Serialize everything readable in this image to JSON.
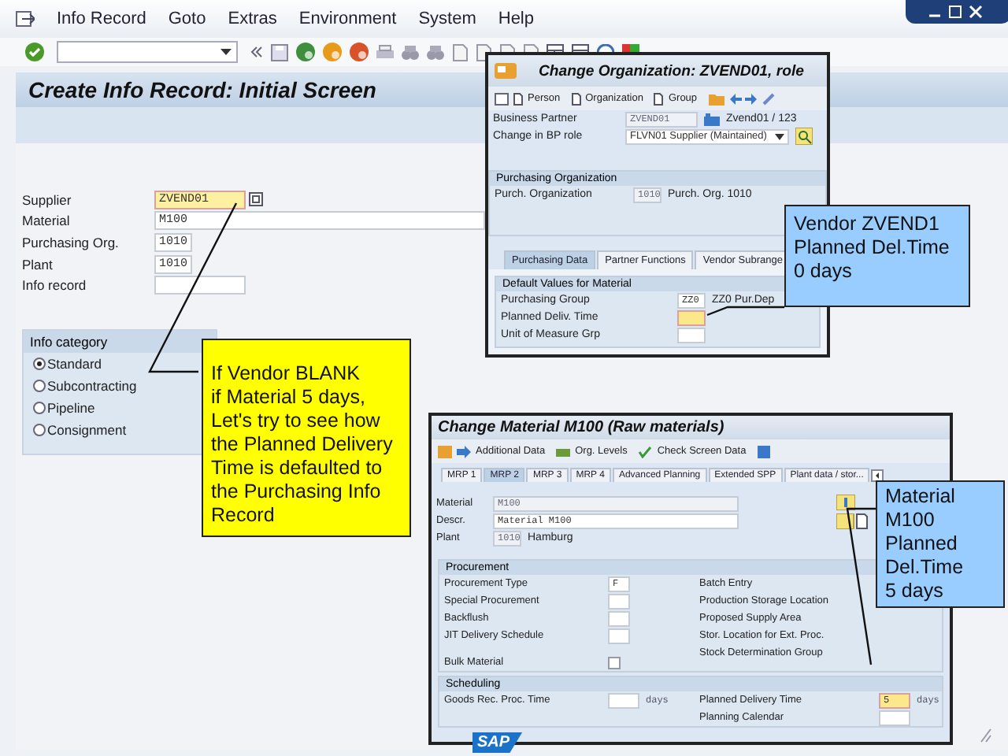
{
  "menu_bar": [
    {
      "label": "Info Record"
    },
    {
      "label": "Goto"
    },
    {
      "label": "Extras"
    },
    {
      "label": "Environment"
    },
    {
      "label": "System"
    },
    {
      "label": "Help"
    }
  ],
  "screen_title": "Create Info Record: Initial Screen",
  "fields": [
    {
      "label": "Supplier",
      "value": "ZVEND01",
      "focused": true
    },
    {
      "label": "Material",
      "value": "M100",
      "focused": false
    },
    {
      "label": "Purchasing Org.",
      "value": "1010",
      "focused": false
    },
    {
      "label": "Plant",
      "value": "1010",
      "focused": false
    },
    {
      "label": "Info record",
      "focused": false
    }
  ],
  "info_category": {
    "title": "Info category",
    "options": [
      {
        "label": "Standard",
        "selected": true
      },
      {
        "label": "Subcontracting",
        "selected": false
      },
      {
        "label": "Pipeline",
        "selected": false
      },
      {
        "label": "Consignment",
        "selected": false
      }
    ]
  },
  "bp_window": {
    "title": "Change Organization: ZVEND01, role",
    "toolbar": [
      {
        "label": "Person"
      },
      {
        "label": "Organization"
      },
      {
        "label": "Group"
      }
    ],
    "business_partner": {
      "label": "Business Partner",
      "value": "ZVEND01",
      "description": "Zvend01 / 123"
    },
    "bp_role": {
      "label": "Change in BP role",
      "value": "FLVN01 Supplier (Maintained)"
    },
    "purchasing_organization": {
      "title": "Purchasing Organization",
      "label": "Purch. Organization",
      "value": "1010",
      "description": "Purch. Org. 1010"
    },
    "tabs": [
      {
        "label": "Purchasing Data",
        "selected": true
      },
      {
        "label": "Partner Functions",
        "selected": false
      },
      {
        "label": "Vendor Subrange",
        "selected": false
      }
    ],
    "defaults": {
      "title": "Default Values for Material",
      "rows": [
        {
          "label": "Purchasing Group",
          "value": "ZZ0",
          "description": "ZZ0 Pur.Dep",
          "focused": false
        },
        {
          "label": "Planned Deliv. Time",
          "focused": true
        },
        {
          "label": "Unit of Measure Grp",
          "focused": false
        }
      ]
    }
  },
  "material_window": {
    "title": "Change Material M100 (Raw materials)",
    "toolbar": [
      {
        "label": "Additional Data"
      },
      {
        "label": "Org. Levels"
      },
      {
        "label": "Check Screen Data"
      }
    ],
    "tabs": [
      {
        "label": "MRP 1",
        "selected": false
      },
      {
        "label": "MRP 2",
        "selected": true
      },
      {
        "label": "MRP 3",
        "selected": false
      },
      {
        "label": "MRP 4",
        "selected": false
      },
      {
        "label": "Advanced Planning",
        "selected": false
      },
      {
        "label": "Extended SPP",
        "selected": false
      },
      {
        "label": "Plant data / stor...",
        "selected": false
      }
    ],
    "header": [
      {
        "label": "Material",
        "value": "M100",
        "editable": false
      },
      {
        "label": "Descr.",
        "value": "Material M100",
        "editable": true
      },
      {
        "label": "Plant",
        "value": "1010",
        "editable": false,
        "description": "Hamburg"
      }
    ],
    "procurement": {
      "title": "Procurement",
      "left": [
        {
          "kind": "field",
          "label": "Procurement Type",
          "value": "F"
        },
        {
          "kind": "field",
          "label": "Special Procurement"
        },
        {
          "kind": "field",
          "label": "Backflush"
        },
        {
          "kind": "field",
          "label": "JIT Delivery Schedule"
        },
        {
          "kind": "checkbox",
          "label": "Bulk Material",
          "checked": false
        }
      ],
      "right": [
        {
          "label": "Batch Entry"
        },
        {
          "label": "Production Storage Location"
        },
        {
          "label": "Proposed Supply Area"
        },
        {
          "label": "Stor. Location for Ext. Proc."
        },
        {
          "label": "Stock Determination Group"
        }
      ]
    },
    "scheduling": {
      "title": "Scheduling",
      "rows": [
        {
          "left": {
            "label": "Goods Rec. Proc. Time",
            "unit": "days"
          },
          "right": {
            "label": "Planned Delivery Time",
            "value": "5",
            "unit": "days",
            "focused": true
          }
        },
        {
          "right": {
            "label": "Planning Calendar",
            "focused": false
          }
        }
      ]
    }
  },
  "callouts": [
    {
      "text": "If Vendor BLANK\nif Material 5 days,\nLet's try to see how\nthe Planned Delivery\nTime is defaulted to\nthe Purchasing Info\nRecord",
      "color": "#ffff00"
    },
    {
      "text": "Vendor ZVEND1\nPlanned Del.Time\n0 days",
      "color": "#99ccff"
    },
    {
      "text": "Material\nM100\nPlanned\nDel.Time\n5 days",
      "color": "#99ccff"
    }
  ],
  "footer_logo": "SAP"
}
